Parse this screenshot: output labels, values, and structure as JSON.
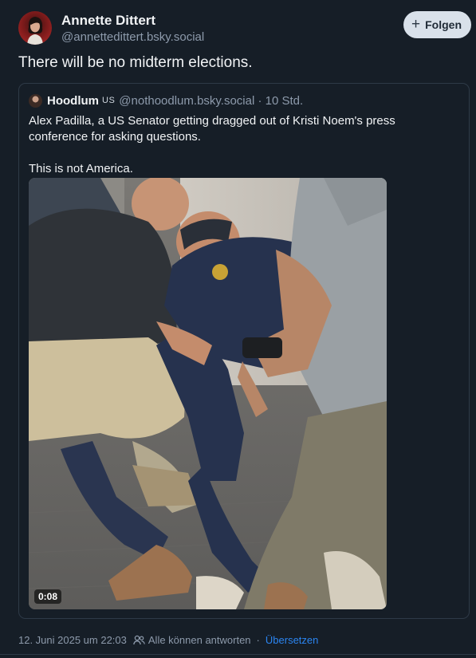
{
  "author": {
    "name": "Annette Dittert",
    "handle": "@annettedittert.bsky.social",
    "avatar_icon": "avatar-portrait"
  },
  "follow_button": {
    "label": "Folgen",
    "icon": "plus-icon"
  },
  "post": {
    "text": "There will be no midterm elections."
  },
  "quoted_post": {
    "author_name": "Hoodlum",
    "author_flag": "US",
    "handle_and_time": "@nothoodlum.bsky.social · 10 Std.",
    "text_line_1": "Alex Padilla, a US Senator getting dragged out of Kristi Noem's press conference for asking questions.",
    "text_line_2": "This is not America.",
    "video": {
      "duration": "0:08"
    }
  },
  "footer": {
    "timestamp": "12. Juni 2025 um 22:03",
    "reply_setting": "Alle können antworten",
    "separator": "·",
    "translate_label": "Übersetzen"
  },
  "colors": {
    "background": "#161e27",
    "accent": "#2b85f1",
    "muted": "#8d9aab",
    "border": "#2e3a47"
  }
}
